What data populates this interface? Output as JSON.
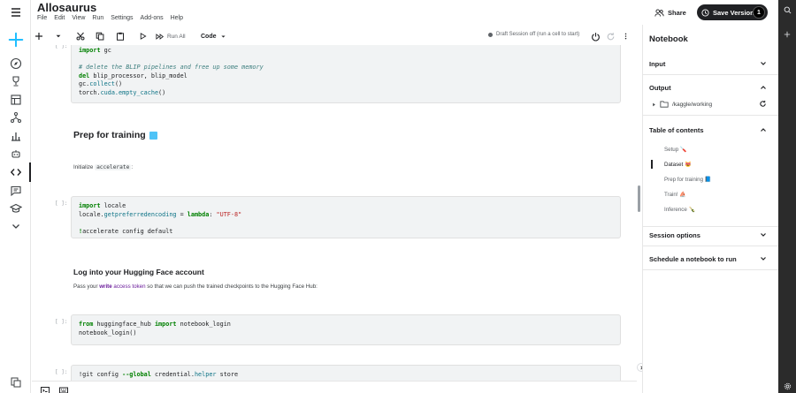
{
  "app": {
    "title": "Allosaurus",
    "menu": [
      "File",
      "Edit",
      "View",
      "Run",
      "Settings",
      "Add-ons",
      "Help"
    ]
  },
  "header": {
    "share_label": "Share",
    "save_label": "Save Version",
    "save_count": "1"
  },
  "toolbar": {
    "run_all_label": "Run All",
    "cell_type": "Code",
    "session_status": "Draft Session off (run a cell to start)"
  },
  "cells": {
    "c1_prompt": "[ ]:",
    "c1_lines": {
      "l1_kw": "import",
      "l1_rest": " gc",
      "l3": "# delete the BLIP pipelines and free up some memory",
      "l4_kw": "del",
      "l4_rest": " blip_processor, blip_model",
      "l5_a": "gc.",
      "l5_fn": "collect",
      "l5_b": "()",
      "l6_a": "torch.",
      "l6_fn": "cuda.empty_cache",
      "l6_b": "()"
    },
    "h_prep": "Prep for training",
    "p_init_a": "Initialize ",
    "p_init_code": "accelerate",
    "p_init_b": ":",
    "c2_prompt": "[ ]:",
    "c2_lines": {
      "l1_kw": "import",
      "l1_rest": " locale",
      "l2_a": "locale.",
      "l2_fn": "getpreferredencoding",
      "l2_b": " = ",
      "l2_kw": "lambda",
      "l2_c": ": ",
      "l2_str": "\"UTF-8\"",
      "l4_kw": "!",
      "l4_rest": "accelerate config default"
    },
    "h_login": "Log into your Hugging Face account",
    "p_login_a": "Pass your ",
    "p_login_write": "write",
    "p_login_link": " access token",
    "p_login_b": " so that we can push the trained checkpoints to the Hugging Face Hub:",
    "c3_prompt": "[ ]:",
    "c3_lines": {
      "l1_kw": "from",
      "l1_a": " huggingface_hub ",
      "l1_kw2": "import",
      "l1_b": " notebook_login",
      "l2": "notebook_login()"
    },
    "c4_prompt": "[ ]:",
    "c4_lines": {
      "l1_a": "!git config ",
      "l1_kw": "--global",
      "l1_b": " credential.",
      "l1_fn": "helper",
      "l1_c": " store"
    }
  },
  "panel": {
    "title": "Notebook",
    "sections": {
      "input": "Input",
      "output": "Output",
      "toc": "Table of contents",
      "session": "Session options",
      "schedule": "Schedule a notebook to run"
    },
    "output_path": "/kaggle/working",
    "toc_items": [
      "Setup 🪛",
      "Dataset 😻",
      "Prep for training 📘",
      "Train! ⛵",
      "Inference 🍾"
    ]
  },
  "colors": {
    "accent": "#20beff",
    "dark": "#202124"
  }
}
